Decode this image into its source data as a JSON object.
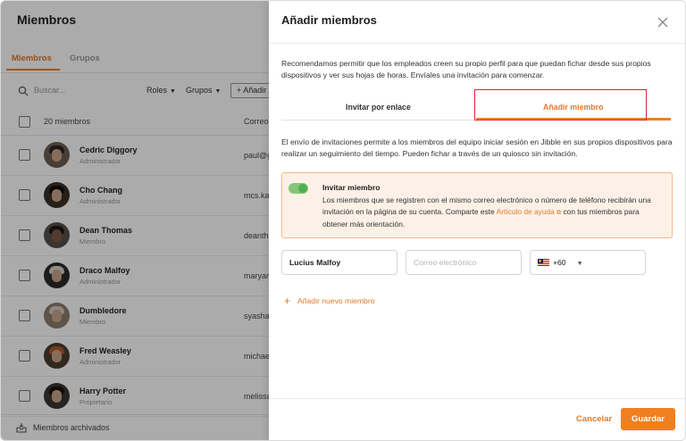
{
  "left": {
    "title": "Miembros",
    "tabs": [
      "Miembros",
      "Grupos"
    ],
    "search_placeholder": "Buscar...",
    "filters": [
      "Roles",
      "Grupos"
    ],
    "add_button": "+ Añadir",
    "header_count": "20 miembros",
    "header_column": "Correo",
    "members": [
      {
        "name": "Cedric Diggory",
        "role": "Administrador",
        "email": "paul@g"
      },
      {
        "name": "Cho Chang",
        "role": "Administrador",
        "email": "mcs.ka"
      },
      {
        "name": "Dean Thomas",
        "role": "Miembro",
        "email": "deanth"
      },
      {
        "name": "Draco Malfoy",
        "role": "Administrador",
        "email": "maryar"
      },
      {
        "name": "Dumbledore",
        "role": "Miembro",
        "email": "syasha"
      },
      {
        "name": "Fred Weasley",
        "role": "Administrador",
        "email": "michae"
      },
      {
        "name": "Harry Potter",
        "role": "Propietario",
        "email": "melissa"
      }
    ],
    "archived": "Miembros archivados"
  },
  "panel": {
    "title": "Añadir miembros",
    "intro": "Recomendamos permitir que los empleados creen su propio perfil para que puedan fichar desde sus propios dispositivos y ver sus hojas de horas. Envíales una invitación para comenzar.",
    "tabs": [
      "Invitar por enlace",
      "Añadir miembro"
    ],
    "description": "El envío de invitaciones permite a los miembros del equipo iniciar sesión en Jibble en sus propios dispositivos para realizar un seguimiento del tiempo. Pueden fichar a través de un quiosco sin invitación.",
    "notice": {
      "title": "Invitar miembro",
      "text_before": "Los miembros que se registren con el mismo correo electrónico o número de teléfono recibirán una invitación en la página de su cuenta. Comparte este ",
      "link": "Artículo de ayuda",
      "text_after": " con tus miembros para obtener más orientación.",
      "toggle_on": true
    },
    "form": {
      "name_value": "Lucius Malfoy",
      "email_placeholder": "Correo electrónico",
      "phone_code": "+60"
    },
    "add_new_member": "Añadir nuevo miembro",
    "cancel": "Cancelar",
    "save": "Guardar"
  },
  "colors": {
    "accent": "#f07f22",
    "highlight": "#d9262e",
    "toggle": "#4caf50"
  }
}
